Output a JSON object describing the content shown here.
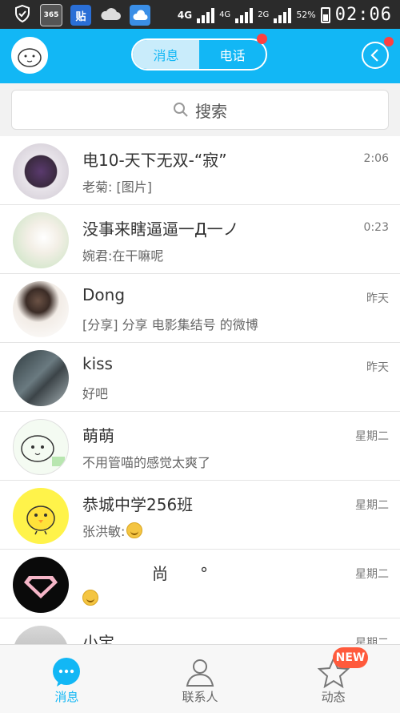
{
  "statusbar": {
    "icons": [
      "shield-icon",
      "calendar-icon",
      "tieba-app-icon",
      "cloud-icon",
      "weather-app-icon"
    ],
    "calendar_day": "365",
    "tieba_label": "贴",
    "network_1": "4G",
    "network_2": "4G",
    "network_3": "2G",
    "battery": "52%",
    "time": "02:06"
  },
  "header": {
    "tab_messages": "消息",
    "tab_calls": "电话"
  },
  "search": {
    "placeholder": "搜索"
  },
  "conversations": [
    {
      "name": "电10-天下无双-“寂”",
      "message": "老菊: [图片]",
      "time": "2:06"
    },
    {
      "name": "没事来瞎逼逼一Д一ノ",
      "message": "婉君:在干嘛呢",
      "time": "0:23"
    },
    {
      "name": "Dong",
      "message": "[分享] 分享 电影集结号 的微博",
      "time": "昨天"
    },
    {
      "name": "kiss",
      "message": "好吧",
      "time": "昨天"
    },
    {
      "name": "萌萌",
      "message": "不用管喵的感觉太爽了",
      "time": "星期二"
    },
    {
      "name": "恭城中学256班",
      "message": "张洪敏:",
      "time": "星期二"
    },
    {
      "name": "尚　　°",
      "message": "",
      "time": "星期二"
    },
    {
      "name": "小宝",
      "message": "",
      "time": "星期二"
    }
  ],
  "tabbar": {
    "messages": "消息",
    "contacts": "联系人",
    "feeds": "动态",
    "new_badge": "NEW"
  },
  "colors": {
    "accent": "#12b7f5",
    "badge": "#ff4040"
  }
}
